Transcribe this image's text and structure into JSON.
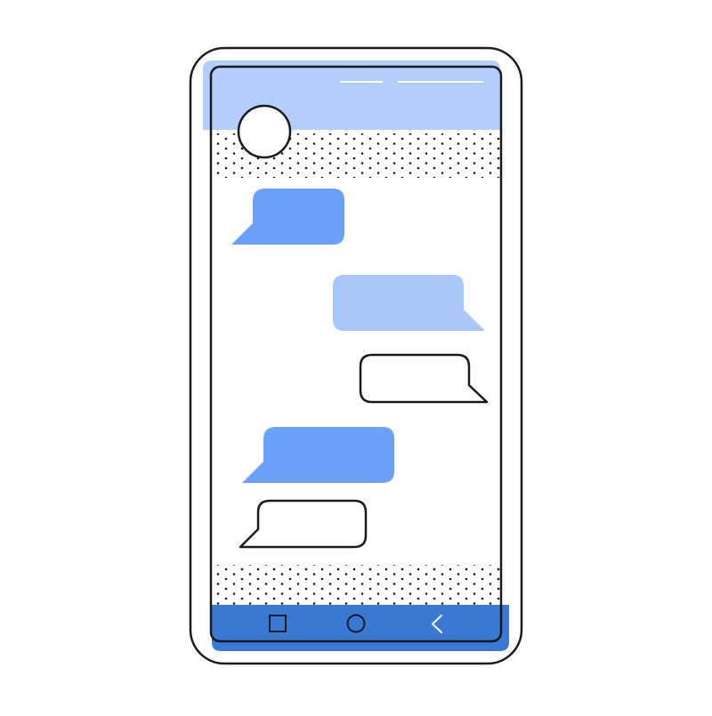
{
  "colors": {
    "outline": "#1a1a1a",
    "header": "#b3cdfd",
    "nav_bar": "#3a78d6",
    "bubble_primary": "#6ba0fc",
    "bubble_light": "#aac6f8",
    "bubble_outline_fill": "#ffffff",
    "screen": "#ffffff",
    "dots": "#1a1a1a"
  },
  "header": {
    "indicators": [
      "short-line",
      "long-line"
    ],
    "avatar": "avatar-circle"
  },
  "messages": [
    {
      "side": "left",
      "style": "filled-primary"
    },
    {
      "side": "right",
      "style": "filled-light"
    },
    {
      "side": "right",
      "style": "outline"
    },
    {
      "side": "left",
      "style": "filled-primary"
    },
    {
      "side": "left",
      "style": "outline"
    }
  ],
  "nav_bar": {
    "buttons": [
      {
        "icon": "square-icon",
        "name": "recent-apps-button"
      },
      {
        "icon": "circle-icon",
        "name": "home-button"
      },
      {
        "icon": "chevron-left-icon",
        "name": "back-button"
      }
    ]
  }
}
